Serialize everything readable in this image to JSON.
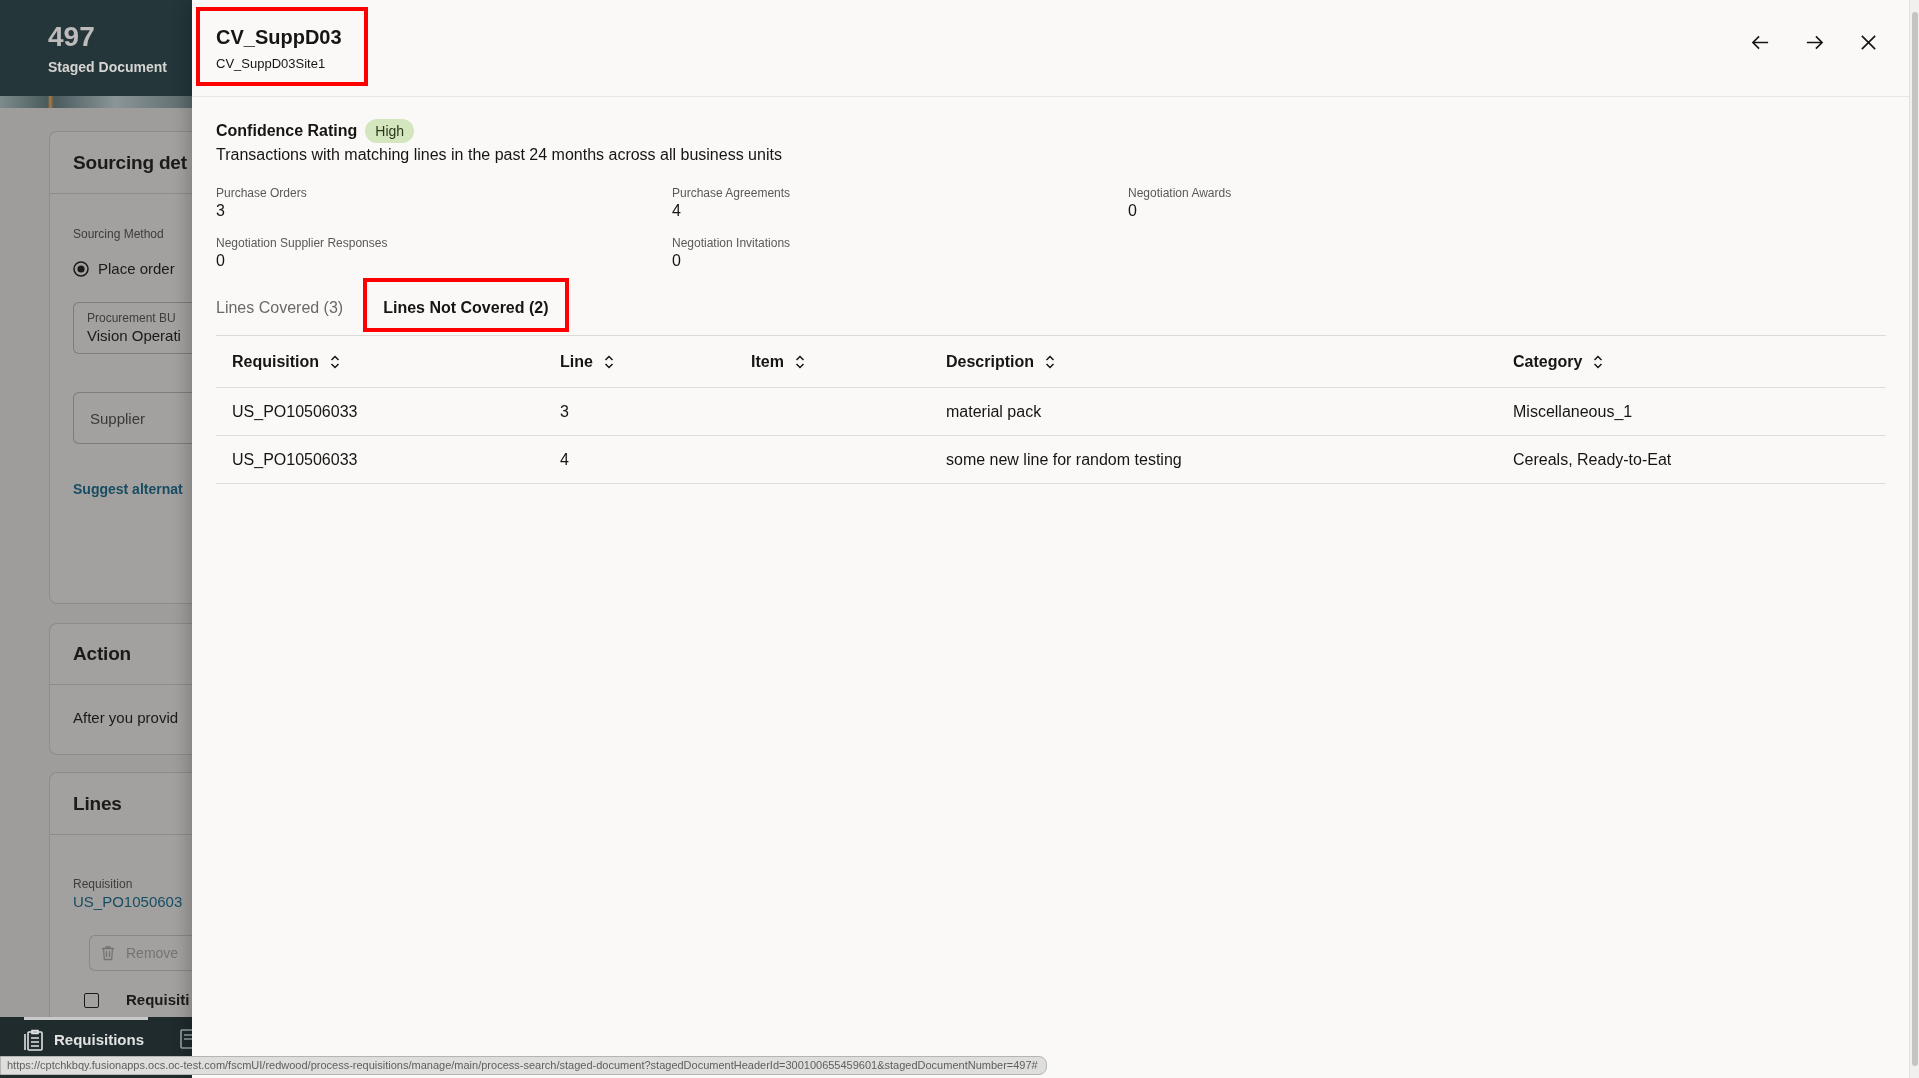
{
  "background_page": {
    "header": {
      "count": "497",
      "label": "Staged Document"
    },
    "sourcing_card": {
      "title": "Sourcing det",
      "method_label": "Sourcing Method",
      "method_option": {
        "label": "Place order",
        "selected": true
      },
      "procurement_bu": {
        "label": "Procurement BU",
        "value": "Vision Operati"
      },
      "supplier": {
        "placeholder": "Supplier"
      },
      "link": "Suggest alternat"
    },
    "action_card": {
      "title": "Action",
      "text": "After you provid"
    },
    "lines_card": {
      "title": "Lines",
      "requisition_label": "Requisition",
      "requisition_link": "US_PO1050603",
      "remove_button": {
        "label": "Remove",
        "disabled": true
      },
      "select_row": {
        "checked": false,
        "label": "Requisiti"
      }
    },
    "bottom_nav": [
      {
        "label": "Requisitions",
        "selected": true
      },
      {
        "selected": false
      }
    ]
  },
  "drawer": {
    "title": "CV_SuppD03",
    "subtitle": "CV_SuppD03Site1",
    "highlighted": true,
    "confidence": {
      "label": "Confidence Rating",
      "badge": "High",
      "description": "Transactions with matching lines in the past 24 months across all business units"
    },
    "metrics": [
      {
        "label": "Purchase Orders",
        "value": "3"
      },
      {
        "label": "Purchase Agreements",
        "value": "4"
      },
      {
        "label": "Negotiation Awards",
        "value": "0"
      },
      {
        "label": "Negotiation Supplier Responses",
        "value": "0"
      },
      {
        "label": "Negotiation Invitations",
        "value": "0"
      }
    ],
    "tabs": [
      {
        "label": "Lines Covered (3)",
        "selected": false,
        "highlighted": false
      },
      {
        "label": "Lines Not Covered (2)",
        "selected": true,
        "highlighted": true
      }
    ],
    "table": {
      "columns": [
        "Requisition",
        "Line",
        "Item",
        "Description",
        "Category"
      ],
      "rows": [
        {
          "requisition": "US_PO10506033",
          "line": "3",
          "description": "material pack",
          "category": "Miscellaneous_1"
        },
        {
          "requisition": "US_PO10506033",
          "line": "4",
          "description": "some new line for random testing",
          "category": "Cereals, Ready-to-Eat"
        }
      ]
    }
  },
  "status_url": "https://cptchkbqy.fusionapps.ocs.oc-test.com/fscmUI/redwood/process-requisitions/manage/main/process-search/staged-document?stagedDocumentHeaderId=300100655459601&stagedDocumentNumber=497#"
}
